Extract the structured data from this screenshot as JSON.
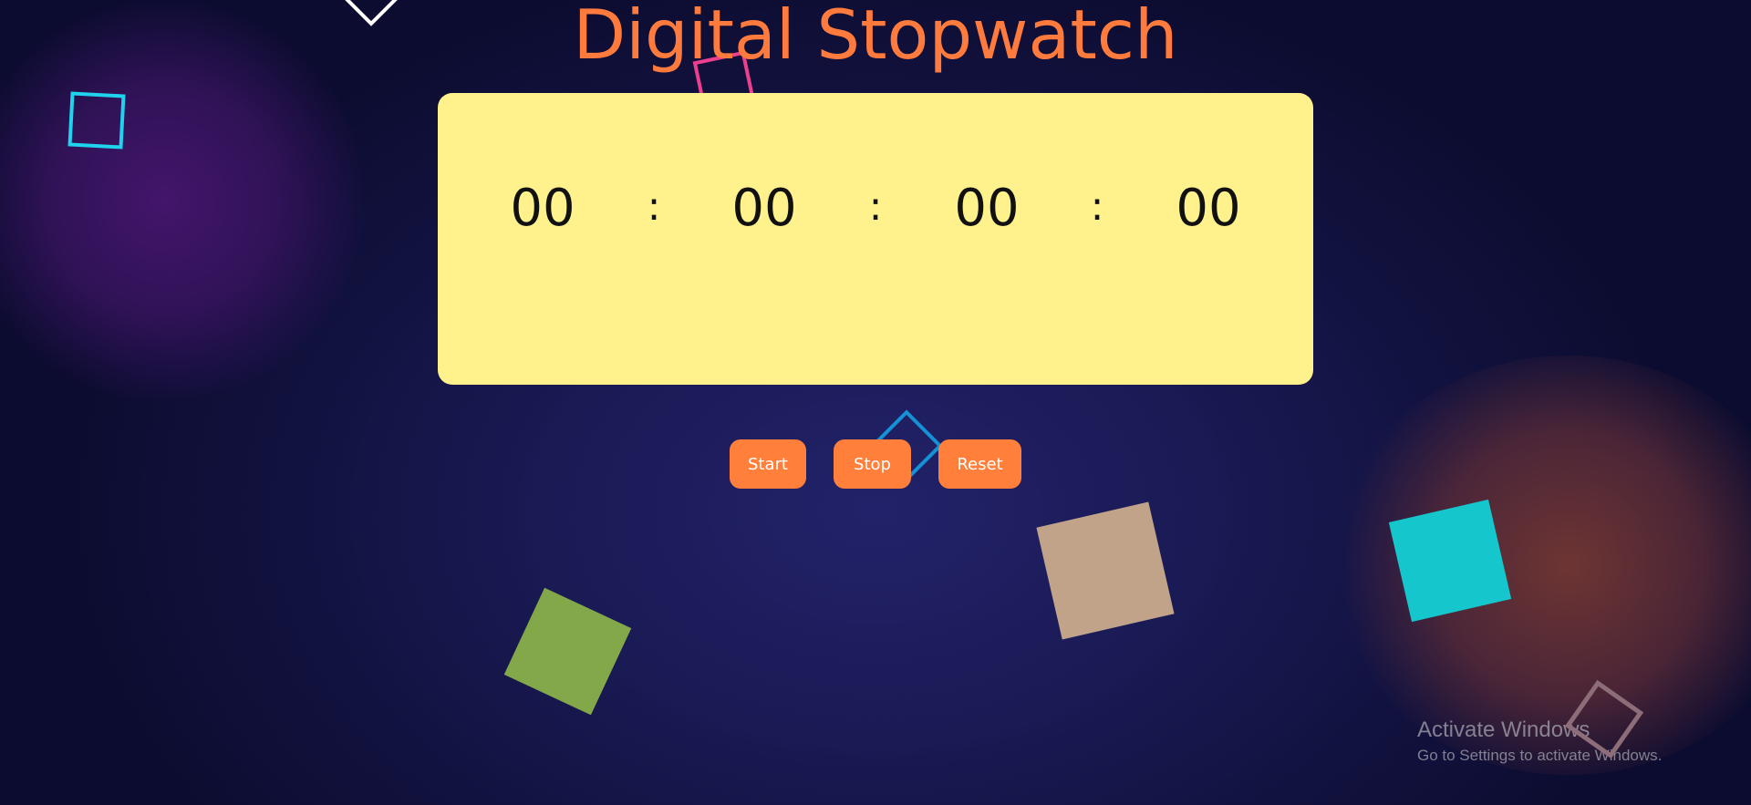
{
  "page": {
    "title": "Digital Stopwatch"
  },
  "display": {
    "segments": [
      "00",
      "00",
      "00",
      "00"
    ],
    "separator": ":"
  },
  "controls": {
    "start_label": "Start",
    "stop_label": "Stop",
    "reset_label": "Reset"
  },
  "watermark": {
    "line1": "Activate Windows",
    "line2": "Go to Settings to activate Windows."
  },
  "colors": {
    "title": "#ff7a3d",
    "panel": "#fff18b",
    "button": "#ff7f3b",
    "button_text": "#ffffff",
    "background": "#1a1a55"
  }
}
